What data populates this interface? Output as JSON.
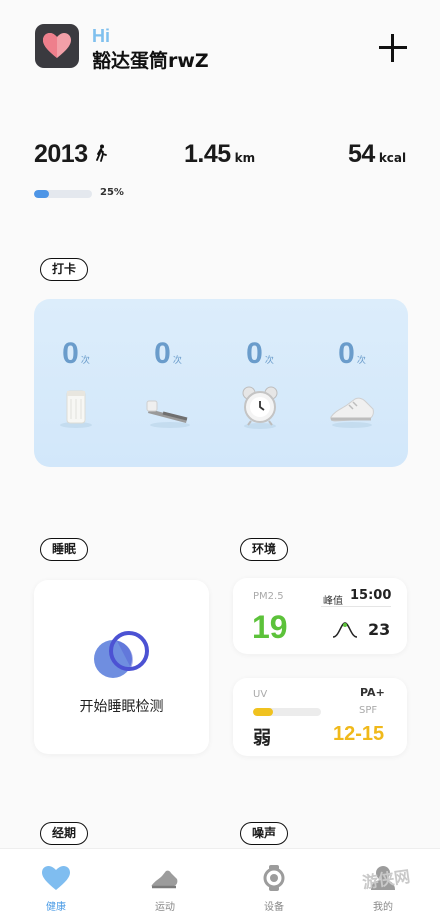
{
  "header": {
    "greeting": "Hi",
    "username": "豁达蛋筒rwZ"
  },
  "stats": {
    "steps": "2013",
    "distance": "1.45",
    "distance_unit": "km",
    "calories": "54",
    "calories_unit": "kcal",
    "goal_progress_label": "25%",
    "goal_progress": 0.25
  },
  "sections": {
    "checkin": "打卡",
    "sleep": "睡眠",
    "environment": "环境",
    "period": "经期",
    "noise": "噪声"
  },
  "checkin_items": [
    {
      "count": "0",
      "unit": "次",
      "icon": "cup-icon"
    },
    {
      "count": "0",
      "unit": "次",
      "icon": "toothbrush-icon"
    },
    {
      "count": "0",
      "unit": "次",
      "icon": "alarm-clock-icon"
    },
    {
      "count": "0",
      "unit": "次",
      "icon": "sneaker-icon"
    }
  ],
  "sleep": {
    "action": "开始睡眠检测"
  },
  "environment": {
    "pm_label": "PM2.5",
    "pm_value": "19",
    "peak_label": "峰值",
    "peak_time": "15:00",
    "peak_value": "23"
  },
  "uv": {
    "label": "UV",
    "level": "弱",
    "pa": "PA+",
    "spf_label": "SPF",
    "spf_value": "12-15",
    "level_fraction": 0.3
  },
  "tabs": [
    {
      "label": "健康",
      "icon": "heart-icon",
      "active": true
    },
    {
      "label": "运动",
      "icon": "shoe-icon",
      "active": false
    },
    {
      "label": "设备",
      "icon": "watch-icon",
      "active": false
    },
    {
      "label": "我的",
      "icon": "profile-icon",
      "active": false
    }
  ],
  "watermark": "游侠网",
  "colors": {
    "accent_blue": "#4a9be6",
    "pm_green": "#5cc23a",
    "uv_yellow": "#f0c21f"
  }
}
